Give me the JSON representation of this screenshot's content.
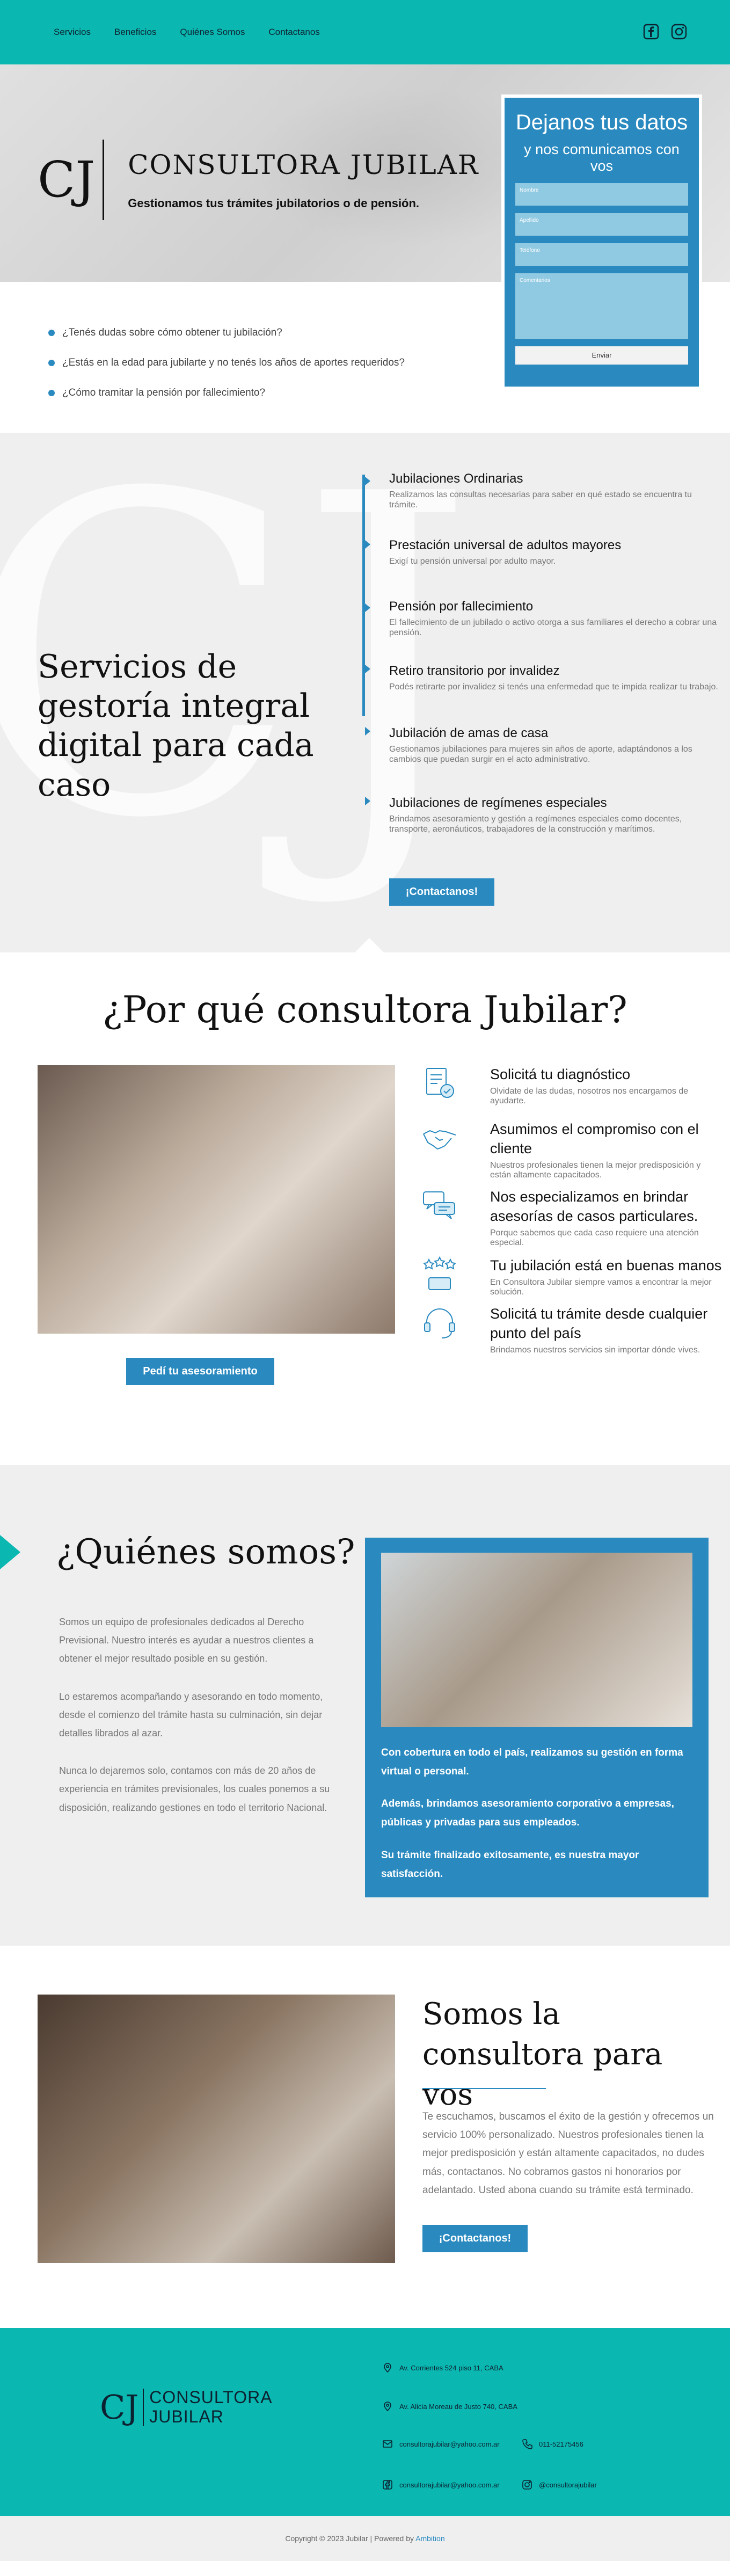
{
  "nav": {
    "items": [
      "Servicios",
      "Beneficios",
      "Quiénes Somos",
      "Contactanos"
    ],
    "social": [
      "facebook-icon",
      "instagram-icon"
    ]
  },
  "hero": {
    "monogram": "CJ",
    "title": "CONSULTORA JUBILAR",
    "subtitle": "Gestionamos tus trámites jubilatorios o de pensión."
  },
  "form": {
    "title": "Dejanos tus datos",
    "subtitle": "y nos comunicamos con vos",
    "fields": [
      "Nombre",
      "Apellido",
      "Teléfono",
      "Comentarios"
    ],
    "submit": "Enviar"
  },
  "questions": [
    "¿Tenés dudas sobre cómo obtener tu jubilación?",
    "¿Estás en la edad para jubilarte y no tenés los años de aportes requeridos?",
    "¿Cómo tramitar la pensión por fallecimiento?"
  ],
  "services": {
    "heading": "Servicios de gestoría integral digital para cada caso",
    "items": [
      {
        "title": "Jubilaciones Ordinarias",
        "text": "Realizamos las consultas necesarias para saber en qué estado se encuentra tu trámite."
      },
      {
        "title": "Prestación universal de adultos mayores",
        "text": "Exigí tu pensión universal por adulto mayor."
      },
      {
        "title": "Pensión por fallecimiento",
        "text": "El fallecimiento de un jubilado o activo otorga a sus familiares el derecho a cobrar una pensión."
      },
      {
        "title": "Retiro transitorio por invalidez",
        "text": "Podés retirarte por invalidez si tenés una enfermedad que te impida realizar tu trabajo."
      },
      {
        "title": "Jubilación de amas de casa",
        "text": "Gestionamos jubilaciones para mujeres sin años de aporte, adaptándonos a los cambios que puedan surgir en el acto administrativo."
      },
      {
        "title": "Jubilaciones de regímenes especiales",
        "text": "Brindamos asesoramiento y gestión a regímenes especiales como docentes, transporte, aeronáuticos, trabajadores de la construcción y marítimos."
      }
    ],
    "button": "¡Contactanos!"
  },
  "why": {
    "title": "¿Por qué consultora Jubilar?",
    "button": "Pedí tu asesoramiento",
    "features": [
      {
        "icon": "document-check-icon",
        "title": "Solicitá tu diagnóstico",
        "text": "Olvidate de las dudas, nosotros nos encargamos de ayudarte."
      },
      {
        "icon": "handshake-icon",
        "title": "Asumimos el compromiso con el cliente",
        "text": "Nuestros profesionales tienen la mejor predisposición y están altamente capacitados."
      },
      {
        "icon": "chat-bubbles-icon",
        "title": "Nos especializamos en brindar asesorías de casos particulares.",
        "text": "Porque sabemos que cada caso requiere una atención especial."
      },
      {
        "icon": "stars-award-icon",
        "title": "Tu jubilación está en buenas manos",
        "text": "En Consultora Jubilar siempre vamos a encontrar la mejor solución."
      },
      {
        "icon": "headset-icon",
        "title": "Solicitá tu trámite desde cualquier punto del país",
        "text": "Brindamos nuestros servicios sin importar dónde vives."
      }
    ]
  },
  "about": {
    "title": "¿Quiénes somos?",
    "paragraphs": [
      "Somos un equipo de profesionales dedicados al Derecho Previsional. Nuestro interés es ayudar a nuestros clientes a obtener el mejor resultado posible en su gestión.",
      "Lo estaremos acompañando y asesorando en todo momento, desde el comienzo del trámite hasta su culminación, sin dejar detalles librados al azar.",
      "Nunca lo dejaremos solo, contamos con más de 20 años de experiencia en trámites previsionales, los cuales ponemos a su disposición, realizando gestiones en todo el territorio Nacional."
    ],
    "card_paragraphs": [
      "Con cobertura en todo el país, realizamos su gestión en forma virtual o personal.",
      "Además, brindamos asesoramiento corporativo a empresas, públicas y privadas para sus empleados.",
      "Su trámite finalizado exitosamente, es nuestra mayor satisfacción."
    ]
  },
  "personal": {
    "title": "Somos la consultora para vos",
    "text": "Te escuchamos, buscamos el éxito de la gestión y ofrecemos un servicio 100% personalizado. Nuestros profesionales tienen la mejor predisposición y están altamente capacitados, no dudes más, contactanos. No cobramos gastos ni honorarios por adelantado. Usted abona cuando su trámite está terminado.",
    "button": "¡Contactanos!"
  },
  "footer": {
    "brand_line1": "CONSULTORA",
    "brand_line2": "JUBILAR",
    "address1": "Av. Corrientes 524 piso 11, CABA",
    "address2": "Av. Alicia Moreau de Justo 740, CABA",
    "email1": "consultorajubilar@yahoo.com.ar",
    "phone": "011-52175456",
    "email2": "consultorajubilar@yahoo.com.ar",
    "instagram": "@consultorajubilar"
  },
  "copyright": {
    "text": "Copyright © 2023 Jubilar | Powered by",
    "link": "Ambition"
  }
}
